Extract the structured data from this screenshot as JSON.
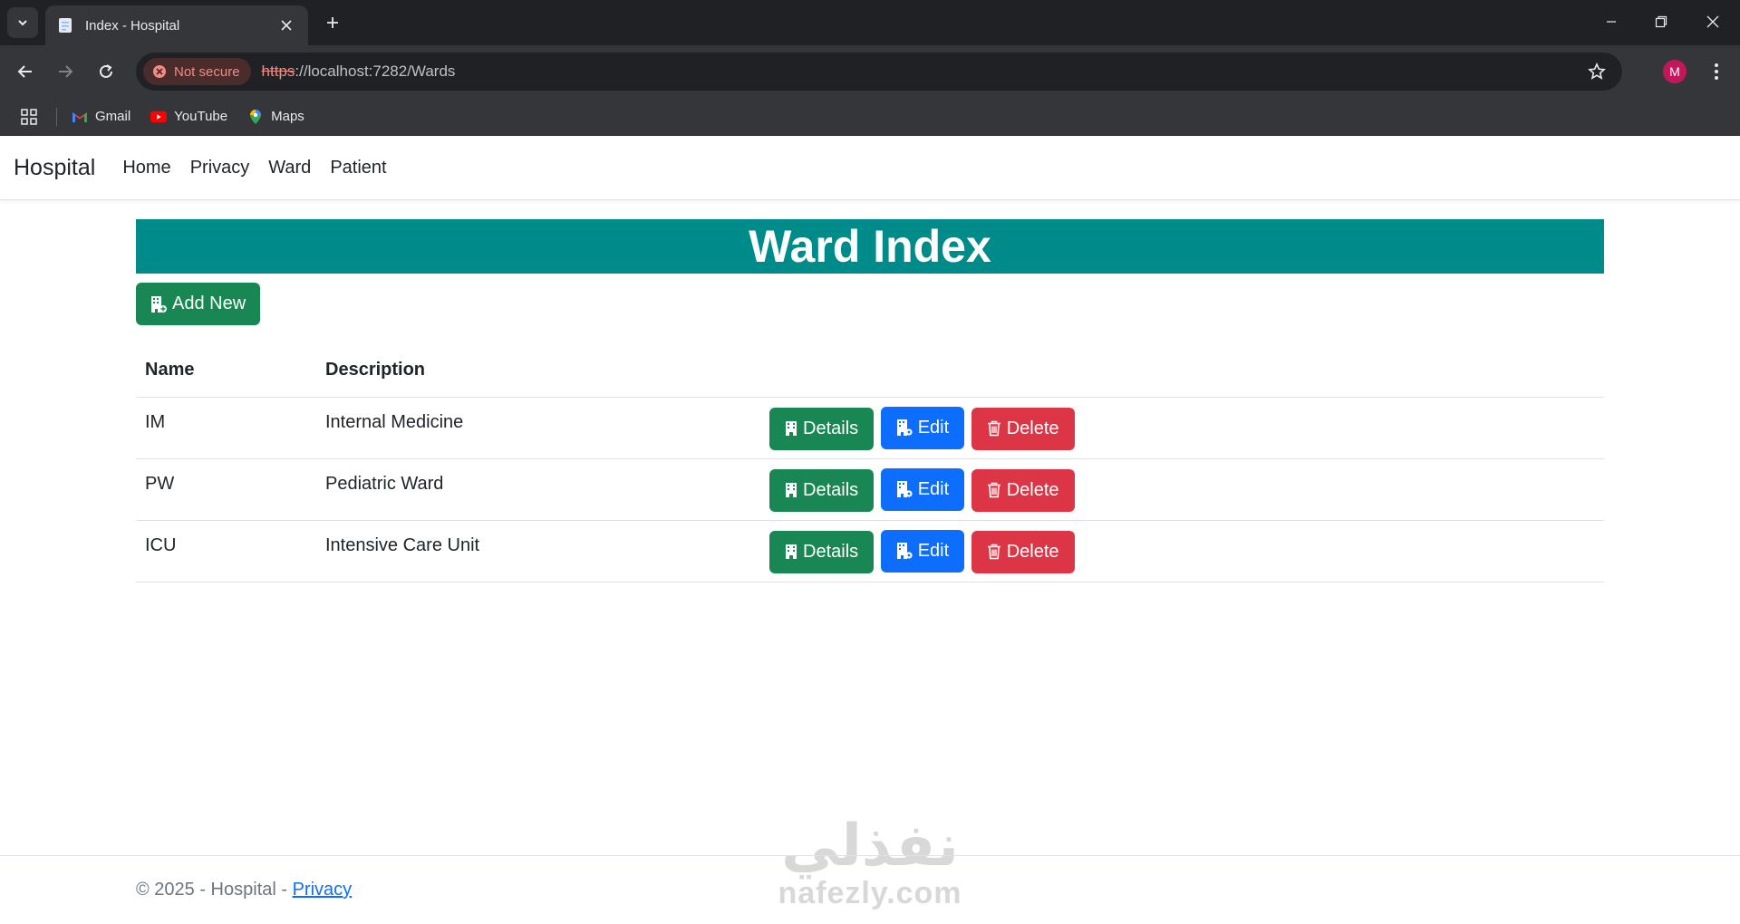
{
  "browser": {
    "tab_title": "Index - Hospital",
    "security_label": "Not secure",
    "url_scheme": "https",
    "url_rest": "://localhost:7282/Wards",
    "profile_initial": "M",
    "bookmarks": [
      {
        "label": "Gmail",
        "icon": "gmail-icon"
      },
      {
        "label": "YouTube",
        "icon": "youtube-icon"
      },
      {
        "label": "Maps",
        "icon": "maps-icon"
      }
    ]
  },
  "navbar": {
    "brand": "Hospital",
    "links": [
      "Home",
      "Privacy",
      "Ward",
      "Patient"
    ]
  },
  "main": {
    "title": "Ward Index",
    "add_new_label": "Add New",
    "columns": {
      "name": "Name",
      "description": "Description"
    },
    "actions": {
      "details": "Details",
      "edit": "Edit",
      "delete": "Delete"
    },
    "rows": [
      {
        "name": "IM",
        "description": "Internal Medicine"
      },
      {
        "name": "PW",
        "description": "Pediatric Ward"
      },
      {
        "name": "ICU",
        "description": "Intensive Care Unit"
      }
    ]
  },
  "footer": {
    "text": "© 2025 - Hospital - ",
    "link": "Privacy"
  },
  "watermark": {
    "arabic": "نفذلي",
    "latin": "nafezly.com"
  },
  "colors": {
    "title_bg": "#008b8b",
    "success": "#198754",
    "primary": "#0d6efd",
    "danger": "#dc3545"
  }
}
